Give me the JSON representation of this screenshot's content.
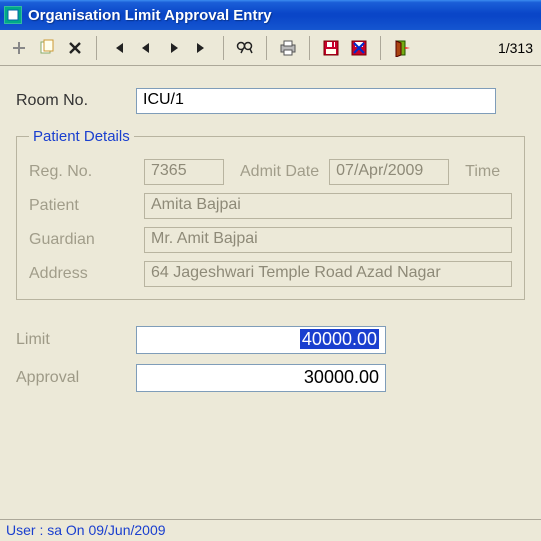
{
  "window": {
    "title": "Organisation Limit Approval Entry"
  },
  "toolbar": {
    "record_counter": "1/313"
  },
  "form": {
    "room_no_label": "Room No.",
    "room_no_value": "ICU/1"
  },
  "patient": {
    "legend": "Patient Details",
    "reg_no_label": "Reg. No.",
    "reg_no_value": "7365",
    "admit_date_label": "Admit Date",
    "admit_date_value": "07/Apr/2009",
    "time_label": "Time",
    "patient_label": "Patient",
    "patient_value": "Amita Bajpai",
    "guardian_label": "Guardian",
    "guardian_value": "Mr. Amit Bajpai",
    "address_label": "Address",
    "address_value": "64 Jageshwari Temple Road Azad Nagar"
  },
  "limits": {
    "limit_label": "Limit",
    "limit_value": "40000.00",
    "approval_label": "Approval",
    "approval_value": "30000.00"
  },
  "status": {
    "text": "User : sa On 09/Jun/2009"
  }
}
